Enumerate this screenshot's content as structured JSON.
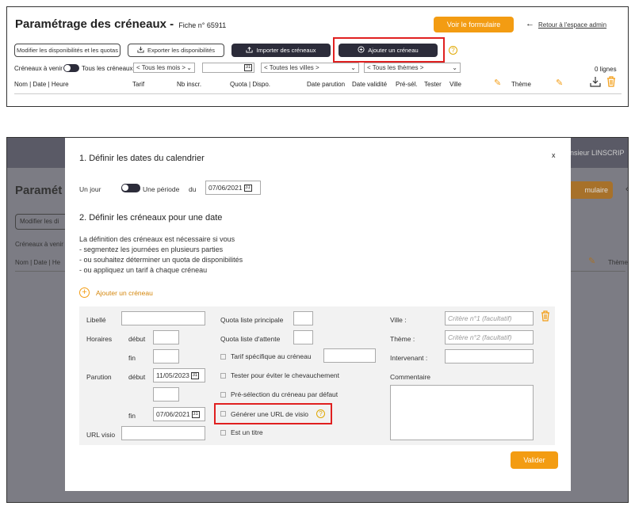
{
  "top": {
    "title": "Paramétrage des créneaux -",
    "fiche": "Fiche n° 65911",
    "view_form_button": "Voir le formulaire",
    "back_arrow": "←",
    "back_link": "Retour à l'espace admin",
    "btn_modify": "Modifier les disponibilités et les quotas",
    "btn_export": "Exporter les disponibilités",
    "btn_import": "Importer des créneaux",
    "btn_add": "Ajouter un créneau",
    "filter_upcoming": "Créneaux à venir",
    "filter_all": "Tous les créneaux",
    "select_months": "< Tous les mois >",
    "select_cities": "< Toutes les villes >",
    "select_themes": "< Tous les thèmes >",
    "line_count": "0 lignes",
    "columns": [
      "Nom | Date | Heure",
      "Tarif",
      "Nb inscr.",
      "Quota | Dispo.",
      "Date parution",
      "Date validité",
      "Pré-sél.",
      "Tester",
      "Ville",
      "Thème"
    ]
  },
  "background": {
    "header_text": "nsieur LINSCRIP",
    "title_partial": "Paramét",
    "btn_partial": "mulaire",
    "modify_partial": "Modifier les di",
    "upcoming_partial": "Créneaux à venir",
    "col_partial": "Nom | Date | He",
    "theme_col": "Thème"
  },
  "modal": {
    "close": "x",
    "section1_title": "1. Définir les dates du calendrier",
    "one_day": "Un jour",
    "period": "Une période",
    "du": "du",
    "date_from": "07/06/2021",
    "section2_title": "2. Définir les créneaux pour une date",
    "description": [
      "La définition des créneaux est nécessaire si vous",
      "- segmentez les journées en plusieurs parties",
      "- ou souhaitez déterminer un quota de disponibilités",
      "- ou appliquez un tarif à chaque créneau"
    ],
    "add_slot": "Ajouter un créneau",
    "form": {
      "libelle": "Libellé",
      "horaires": "Horaires",
      "debut": "début",
      "fin": "fin",
      "parution": "Parution",
      "parution_debut_value": "11/05/2023",
      "parution_fin_value": "07/06/2021",
      "url_visio": "URL visio",
      "quota_principale": "Quota liste principale",
      "quota_attente": "Quota liste d'attente",
      "tarif_specifique": "Tarif spécifique au créneau",
      "tester": "Tester pour éviter le chevauchement",
      "preselection": "Pré-sélection du créneau par défaut",
      "generer_url": "Générer une URL de visio",
      "est_titre": "Est un titre",
      "ville": "Ville :",
      "ville_placeholder": "Critère n°1 (facultatif)",
      "theme": "Thème :",
      "theme_placeholder": "Critère n°2 (facultatif)",
      "intervenant": "Intervenant :",
      "commentaire": "Commentaire"
    },
    "validate": "Valider"
  },
  "colors": {
    "accent_orange": "#f39c12",
    "dark_button": "#2c2c3a",
    "highlight_red": "#e02020"
  }
}
